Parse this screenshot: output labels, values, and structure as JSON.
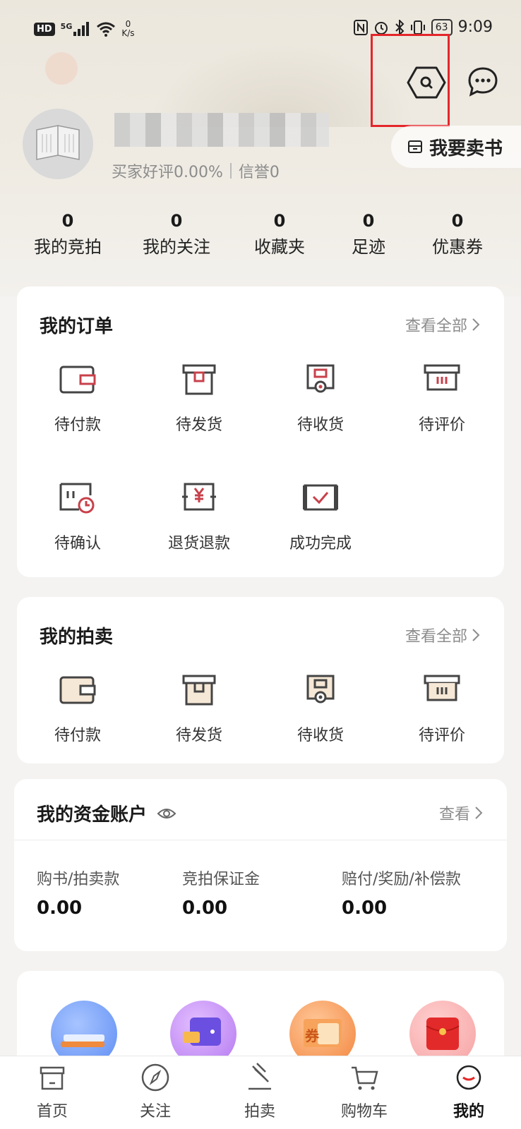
{
  "status_bar": {
    "hd": "HD",
    "signal": "5G",
    "speed_value": "0",
    "speed_unit": "K/s",
    "battery": "63",
    "time": "9:09"
  },
  "profile": {
    "rating_label": "买家好评0.00%",
    "credit_label": "信誉0",
    "sell_button": "我要卖书"
  },
  "stats": [
    {
      "value": "0",
      "label": "我的竞拍"
    },
    {
      "value": "0",
      "label": "我的关注"
    },
    {
      "value": "0",
      "label": "收藏夹"
    },
    {
      "value": "0",
      "label": "足迹"
    },
    {
      "value": "0",
      "label": "优惠券"
    }
  ],
  "orders": {
    "title": "我的订单",
    "view_all": "查看全部",
    "items": [
      "待付款",
      "待发货",
      "待收货",
      "待评价",
      "待确认",
      "退货退款",
      "成功完成"
    ]
  },
  "auctions": {
    "title": "我的拍卖",
    "view_all": "查看全部",
    "items": [
      "待付款",
      "待发货",
      "待收货",
      "待评价"
    ]
  },
  "funds": {
    "title": "我的资金账户",
    "view": "查看",
    "columns": [
      {
        "label": "购书/拍卖款",
        "value": "0.00"
      },
      {
        "label": "竞拍保证金",
        "value": "0.00"
      },
      {
        "label": "赔付/奖励/补偿款",
        "value": "0.00"
      }
    ],
    "coupon_glyph": "券"
  },
  "tab_bar": {
    "items": [
      "首页",
      "关注",
      "拍卖",
      "购物车",
      "我的"
    ],
    "active": "我的"
  },
  "colors": {
    "accent": "#c8414b",
    "highlight_box": "#e4262b",
    "text_muted": "#8c8c8c"
  }
}
